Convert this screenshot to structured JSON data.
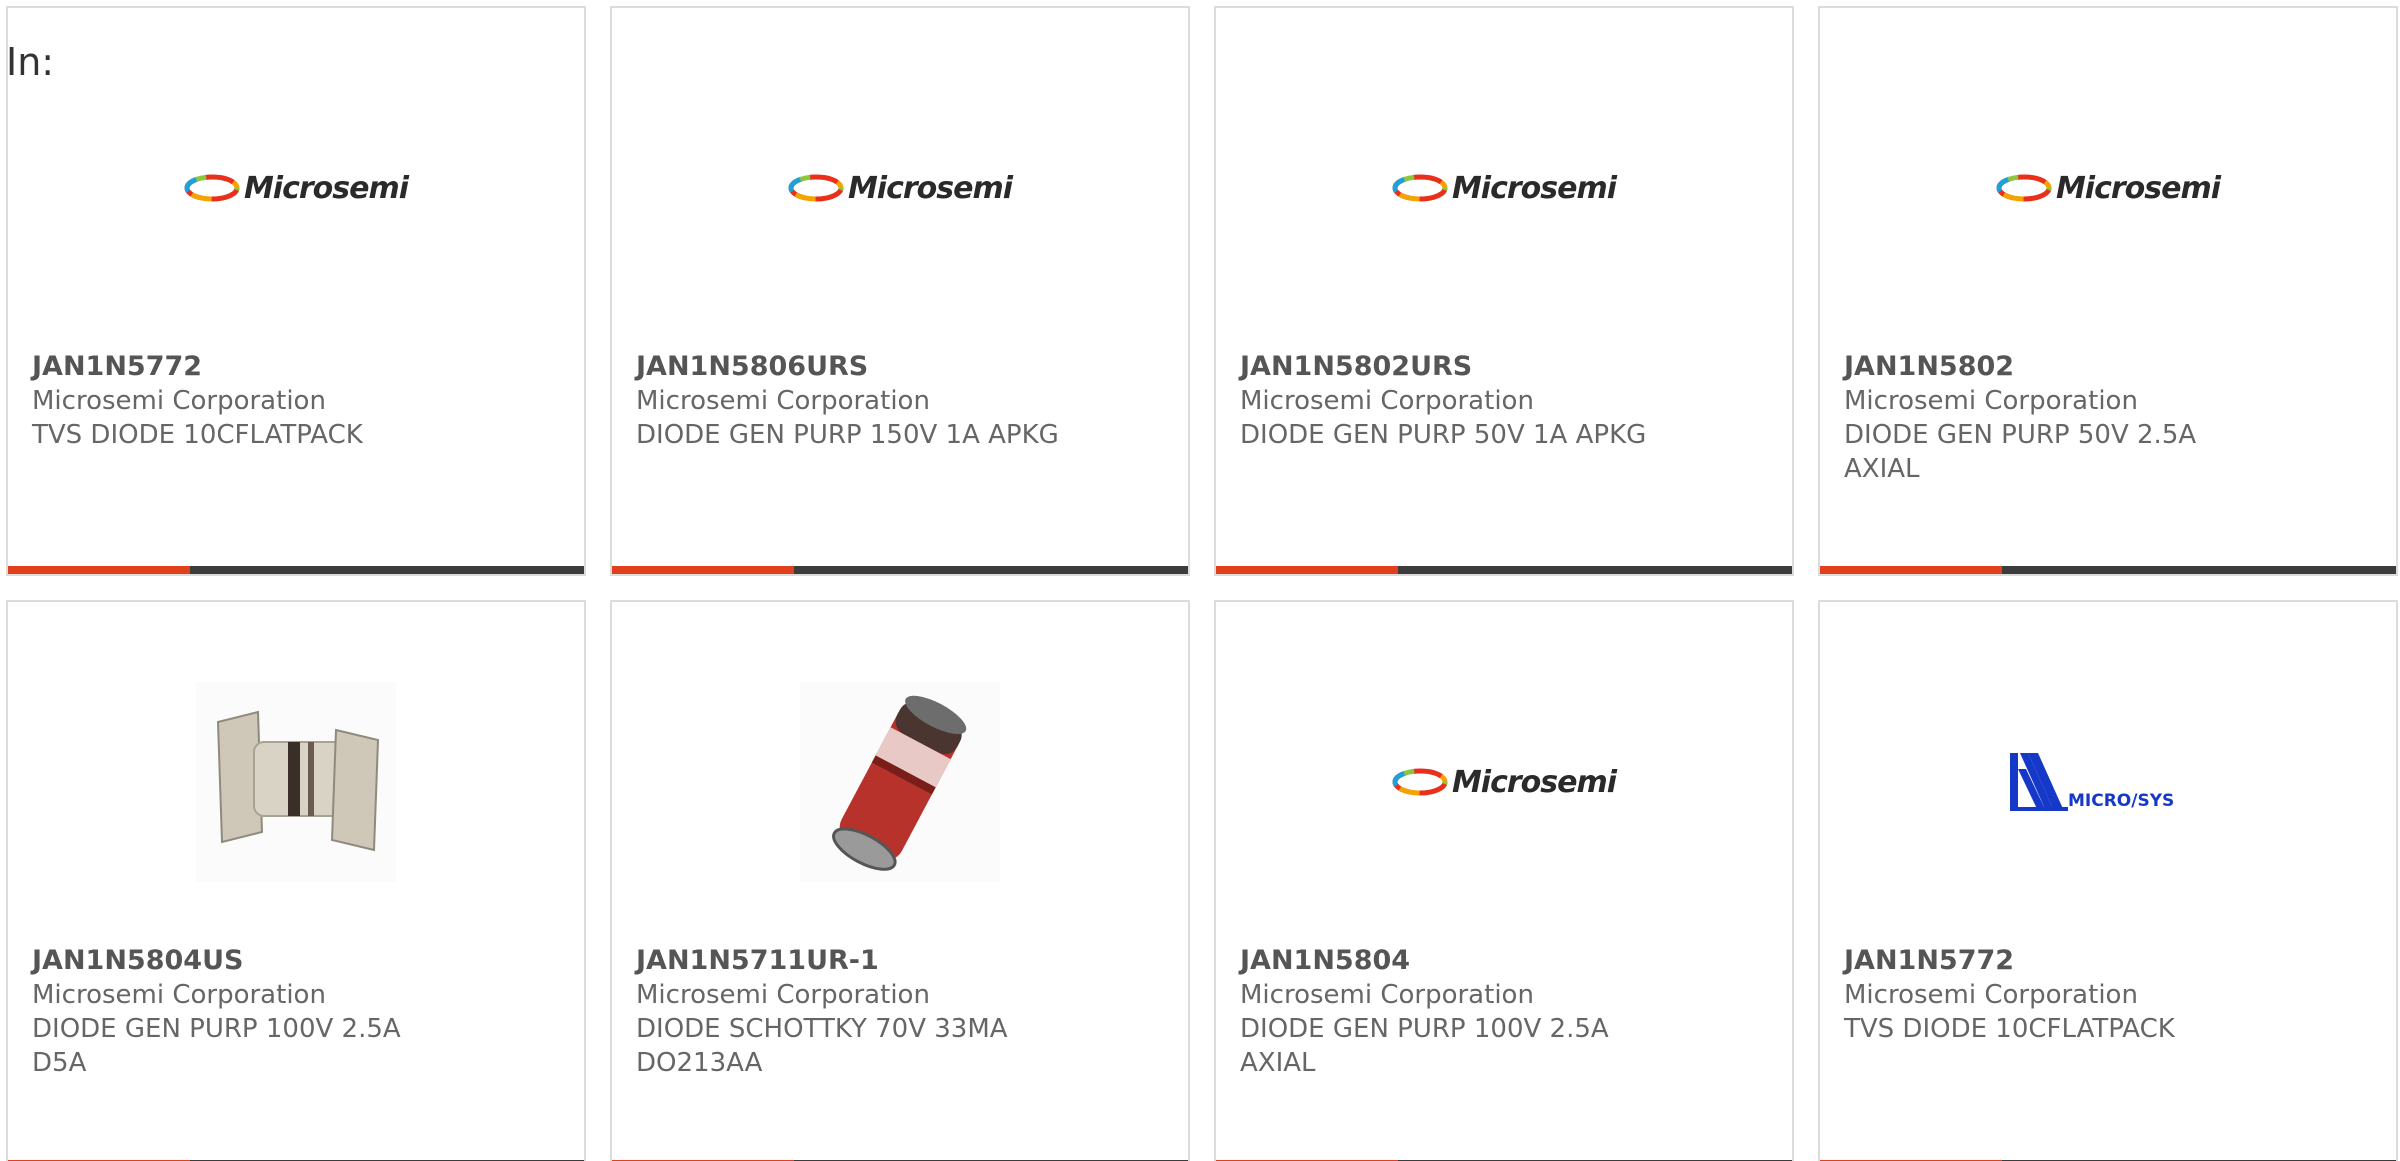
{
  "header": {
    "label": "In:"
  },
  "colors": {
    "accent": "#e0401c",
    "bar": "#3c3c3c",
    "card_border": "#dcdcdc",
    "text": "#666666",
    "microsys_blue": "#1538c8"
  },
  "logos": {
    "microsemi": "Microsemi",
    "microsys": "MICRO/SYS"
  },
  "products": [
    {
      "part": "JAN1N5772",
      "maker": "Microsemi Corporation",
      "desc": "TVS DIODE 10CFLATPACK",
      "image": "microsemi-logo"
    },
    {
      "part": "JAN1N5806URS",
      "maker": "Microsemi Corporation",
      "desc": "DIODE GEN PURP 150V 1A APKG",
      "image": "microsemi-logo"
    },
    {
      "part": "JAN1N5802URS",
      "maker": "Microsemi Corporation",
      "desc": "DIODE GEN PURP 50V 1A APKG",
      "image": "microsemi-logo"
    },
    {
      "part": "JAN1N5802",
      "maker": "Microsemi Corporation",
      "desc": "DIODE GEN PURP 50V 2.5A AXIAL",
      "image": "microsemi-logo"
    },
    {
      "part": "JAN1N5804US",
      "maker": "Microsemi Corporation",
      "desc": "DIODE GEN PURP 100V 2.5A D5A",
      "image": "d5a-diode-photo"
    },
    {
      "part": "JAN1N5711UR-1",
      "maker": "Microsemi Corporation",
      "desc": "DIODE SCHOTTKY 70V 33MA DO213AA",
      "image": "do213aa-diode-photo"
    },
    {
      "part": "JAN1N5804",
      "maker": "Microsemi Corporation",
      "desc": "DIODE GEN PURP 100V 2.5A AXIAL",
      "image": "microsemi-logo"
    },
    {
      "part": "JAN1N5772",
      "maker": "Microsemi Corporation",
      "desc": "TVS DIODE 10CFLATPACK",
      "image": "microsys-logo"
    }
  ]
}
